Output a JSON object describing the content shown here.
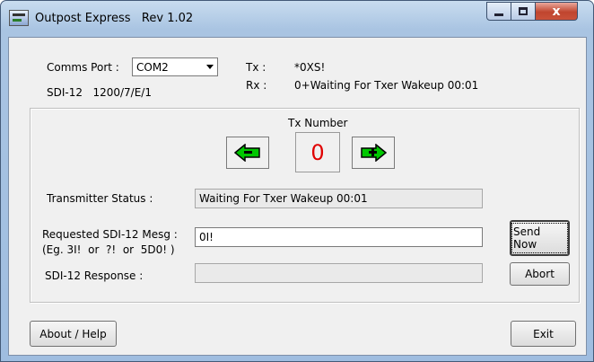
{
  "window": {
    "title": "Outpost Express   Rev 1.02",
    "buttons": {
      "minimize": "",
      "maximize": "",
      "close": "x"
    }
  },
  "comms": {
    "port_label": "Comms Port :",
    "port_value": "COM2",
    "settings": "SDI-12   1200/7/E/1",
    "tx_label": "Tx :",
    "tx_value": "*0XS!",
    "rx_label": "Rx :",
    "rx_value": "0+Waiting For Txer Wakeup 00:01"
  },
  "tx_number": {
    "label": "Tx Number",
    "value": "0",
    "decrement_icon": "left-arrow-icon",
    "increment_icon": "right-arrow-icon",
    "arrow_color": "#00c800",
    "value_color": "#e00000"
  },
  "status": {
    "label": "Transmitter Status :",
    "value": "Waiting For Txer Wakeup 00:01"
  },
  "request": {
    "label": "Requested SDI-12 Mesg :",
    "example": "(Eg. 3I!  or  ?!  or  5D0! )",
    "value": "0I!",
    "send_label": "Send Now"
  },
  "response": {
    "label": "SDI-12 Response :",
    "value": "",
    "abort_label": "Abort"
  },
  "footer": {
    "about_label": "About / Help",
    "exit_label": "Exit"
  }
}
